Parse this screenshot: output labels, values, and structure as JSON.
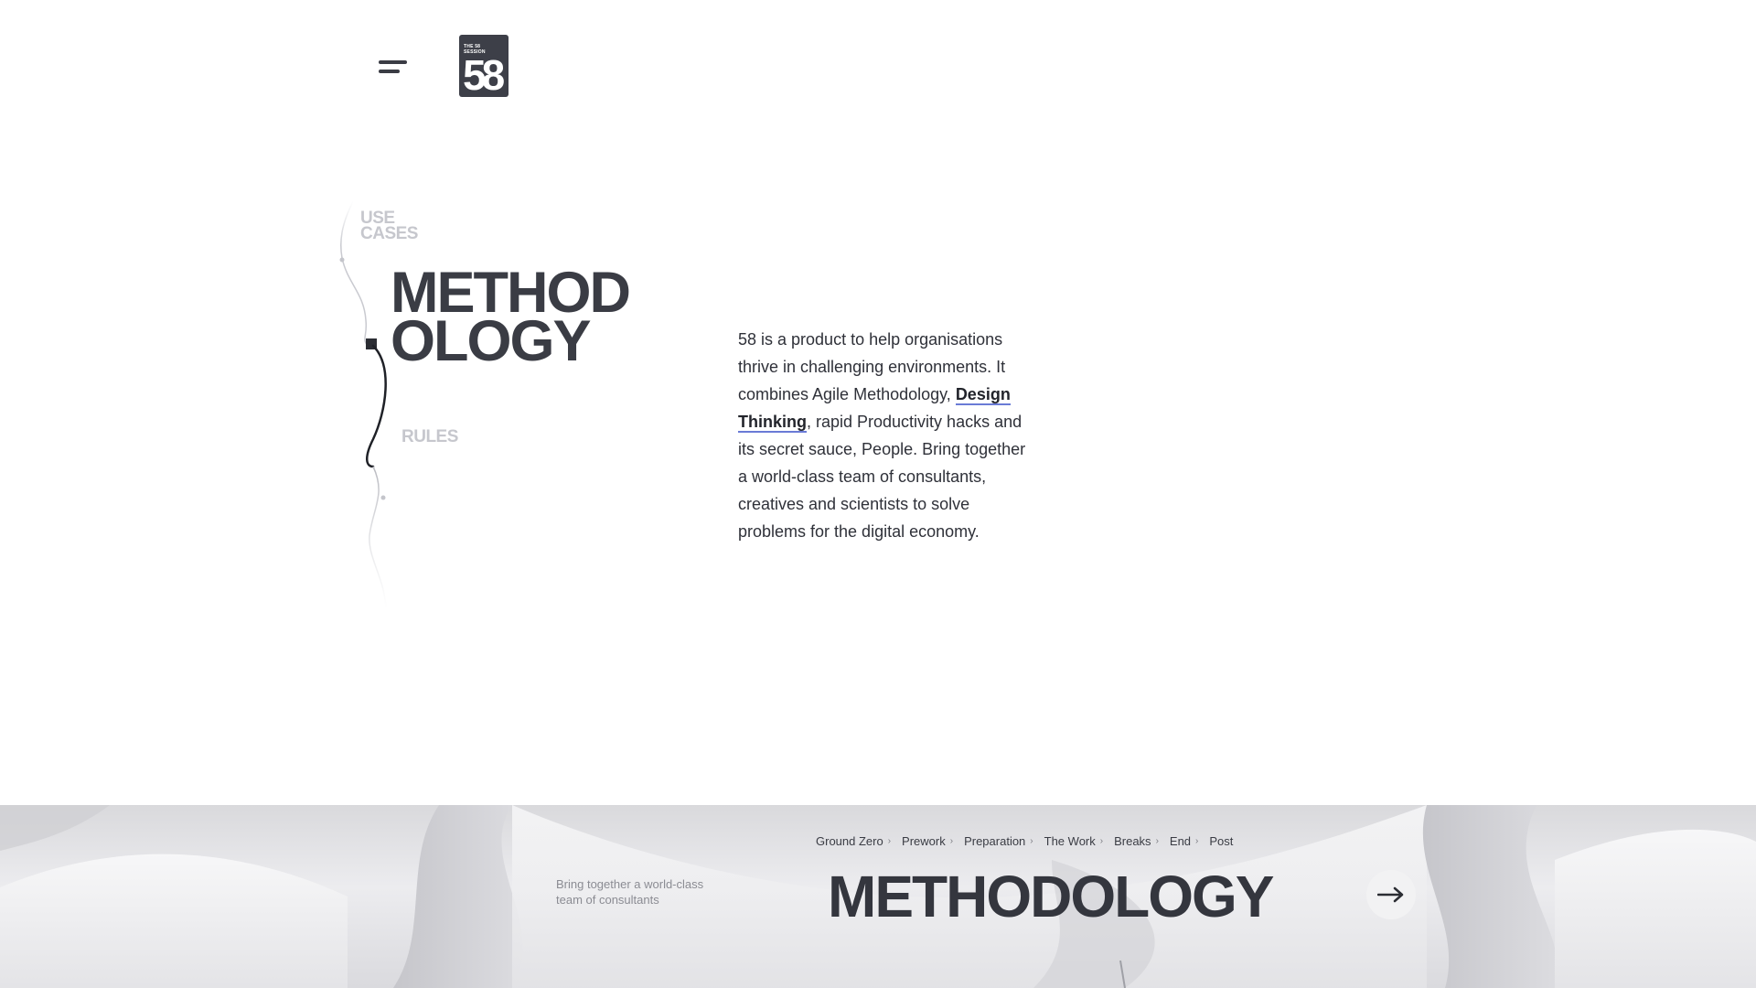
{
  "header": {
    "menu_icon": "hamburger-menu-icon",
    "logo": {
      "small_text": "THE 58 SESSION",
      "number": "58"
    }
  },
  "nav": {
    "previous": "USE CASES",
    "current_line1": "METHOD",
    "current_line2": "OLOGY",
    "next": "RULES"
  },
  "intro": {
    "part1": "58 is a product to help organisations thrive in challenging environments. It combines Agile Methodology, ",
    "highlight": "Design Thinking",
    "part2": ", rapid Productivity hacks and its secret sauce, People. Bring together a world-class team of consultants, creatives and scientists to solve problems for the digital economy."
  },
  "banner": {
    "tagline": "Bring together a world-class team of consultants",
    "breadcrumbs": [
      "Ground Zero",
      "Prework",
      "Preparation",
      "The Work",
      "Breaks",
      "End",
      "Post"
    ],
    "title": "METHODOLOGY",
    "next_icon": "arrow-right-icon"
  },
  "colors": {
    "text_dark": "#3a3c44",
    "text_muted": "#c6c7cd",
    "link_underline": "#6a7bd6",
    "logo_bg": "#3d3f48"
  }
}
